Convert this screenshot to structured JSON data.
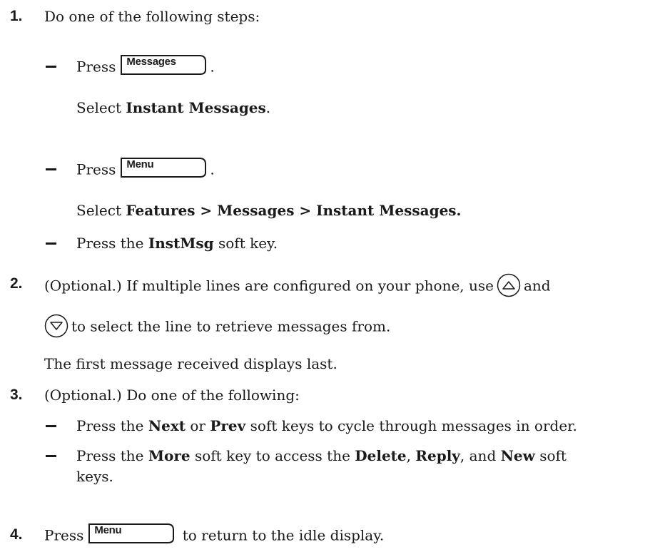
{
  "steps": [
    {
      "number": "1.",
      "text": "Do one of the following steps:",
      "options": [
        {
          "prefix": "Press",
          "key_label": "Messages",
          "suffix": ".",
          "sub_lead": "Select ",
          "sub_bold": "Instant Messages",
          "sub_tail": "."
        },
        {
          "prefix": "Press",
          "key_label": "Menu",
          "suffix": ".",
          "sub_lead": "Select ",
          "sub_bold": "Features > Messages > Instant Messages.",
          "sub_tail": ""
        },
        {
          "lead": "Press the ",
          "bold": "InstMsg",
          "tail": " soft key."
        }
      ]
    },
    {
      "number": "2.",
      "line1": "(Optional.) If multiple lines are configured on your phone, use",
      "line1_end": "and",
      "up_icon": "up-arrow-key-icon",
      "down_icon": "down-arrow-key-icon",
      "line2": "to select the line to retrieve messages from.",
      "note": "The first message received displays last."
    },
    {
      "number": "3.",
      "text": "(Optional.) Do one of the following:",
      "options": [
        {
          "lead": "Press the ",
          "bold1": "Next",
          "mid": " or ",
          "bold2": "Prev",
          "tail": " soft keys to cycle through messages in order."
        },
        {
          "lead": "Press the ",
          "bold1": "More",
          "mid1": " soft key to access the ",
          "bold2": "Delete",
          "mid2": ", ",
          "bold3": "Reply",
          "mid3": ", and ",
          "bold4": "New",
          "tail1": " soft",
          "tail2": "keys."
        }
      ]
    },
    {
      "number": "4.",
      "prefix": "Press",
      "key_label": "Menu",
      "suffix": "to return to the idle display."
    }
  ]
}
